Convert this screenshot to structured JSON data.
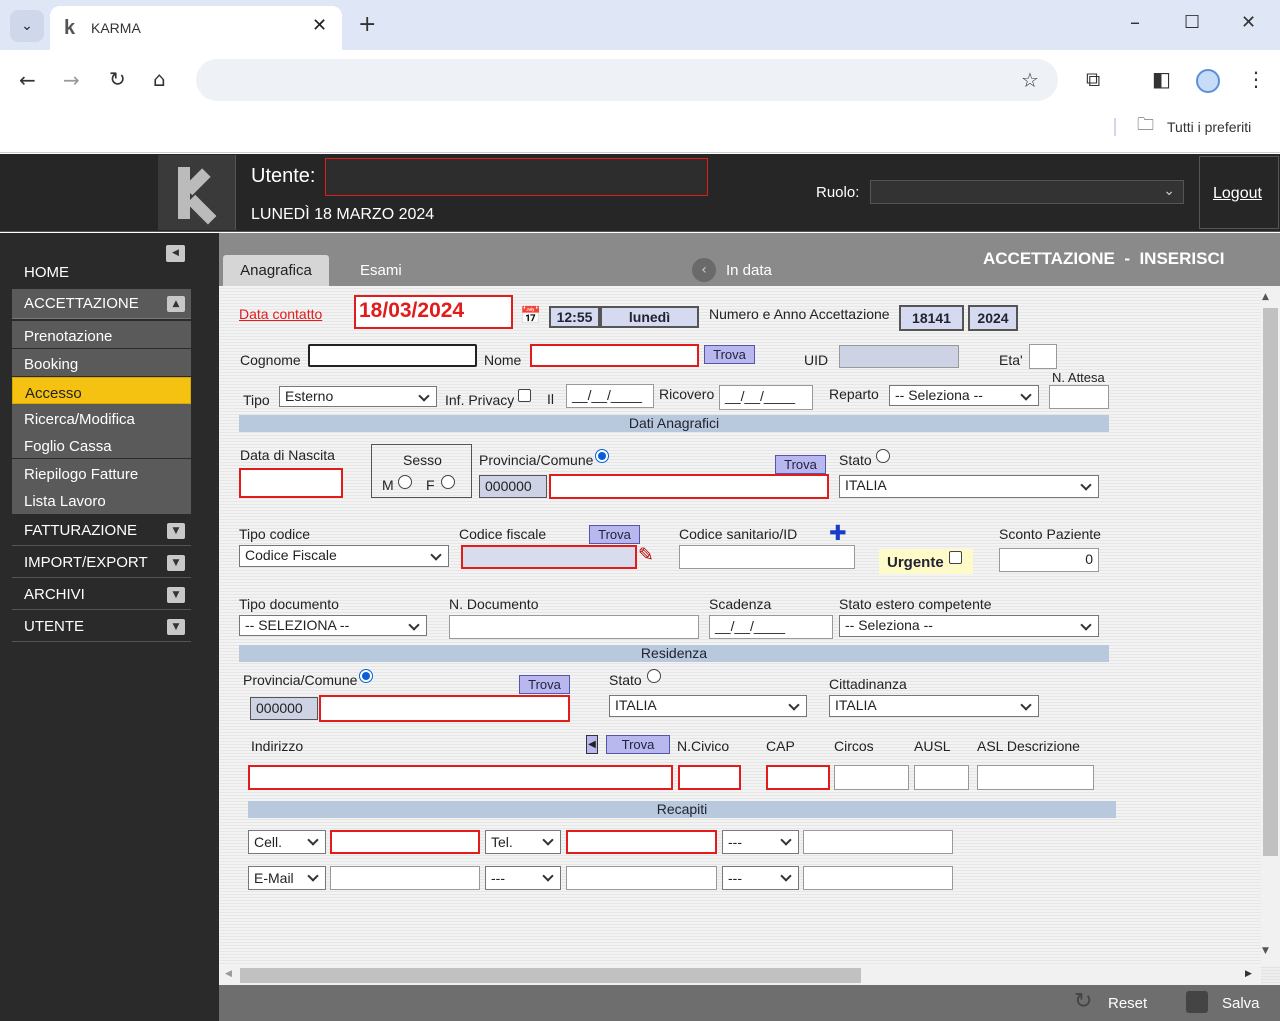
{
  "browser": {
    "tab_title": "KARMA",
    "bookmarks_label": "Tutti i preferiti"
  },
  "header": {
    "user_label": "Utente:",
    "date": "LUNEDÌ 18 MARZO 2024",
    "role_label": "Ruolo:",
    "logout": "Logout"
  },
  "sidebar": {
    "home": "HOME",
    "accettazione": "ACCETTAZIONE",
    "sub": [
      "Prenotazione",
      "Booking",
      "Accesso",
      "Ricerca/Modifica",
      "Foglio Cassa",
      "Riepilogo Fatture",
      "Lista Lavoro"
    ],
    "fatturazione": "FATTURAZIONE",
    "import_export": "IMPORT/EXPORT",
    "archivi": "ARCHIVI",
    "utente": "UTENTE"
  },
  "main": {
    "tab_anagrafica": "Anagrafica",
    "tab_esami": "Esami",
    "in_data": "In data",
    "page_title": "ACCETTAZIONE  -  INSERISCI"
  },
  "form": {
    "data_contatto_label": "Data contatto",
    "data_contatto_value": "18/03/2024",
    "time": "12:55",
    "weekday": "lunedì",
    "numero_label": "Numero e Anno Accettazione",
    "numero": "18141",
    "anno": "2024",
    "cognome": "Cognome",
    "nome": "Nome",
    "trova": "Trova",
    "uid": "UID",
    "eta": "Eta'",
    "tipo": "Tipo",
    "tipo_value": "Esterno",
    "inf_privacy": "Inf. Privacy",
    "il": "Il",
    "date_placeholder": "__/__/____",
    "ricovero": "Ricovero",
    "reparto": "Reparto",
    "reparto_value": "-- Seleziona --",
    "n_attesa": "N. Attesa",
    "dati_anagrafici": "Dati Anagrafici",
    "data_nascita": "Data di Nascita",
    "sesso": "Sesso",
    "m": "M",
    "f": "F",
    "provincia_comune": "Provincia/Comune",
    "stato": "Stato",
    "istat_code": "000000",
    "italia": "ITALIA",
    "tipo_codice": "Tipo codice",
    "tipo_codice_value": "Codice Fiscale",
    "codice_fiscale": "Codice fiscale",
    "codice_sanitario": "Codice sanitario/ID",
    "urgente": "Urgente",
    "sconto_paziente": "Sconto Paziente",
    "sconto_value": "0",
    "tipo_documento": "Tipo documento",
    "tipo_documento_value": "-- SELEZIONA --",
    "n_documento": "N. Documento",
    "scadenza": "Scadenza",
    "stato_estero": "Stato estero competente",
    "stato_estero_value": "-- Seleziona --",
    "residenza": "Residenza",
    "cittadinanza": "Cittadinanza",
    "indirizzo": "Indirizzo",
    "n_civico": "N.Civico",
    "cap": "CAP",
    "circos": "Circos",
    "ausl": "AUSL",
    "asl_descrizione": "ASL Descrizione",
    "recapiti": "Recapiti",
    "cell": "Cell.",
    "tel": "Tel.",
    "dashes": "---",
    "email": "E-Mail"
  },
  "footer": {
    "reset": "Reset",
    "salva": "Salva"
  }
}
